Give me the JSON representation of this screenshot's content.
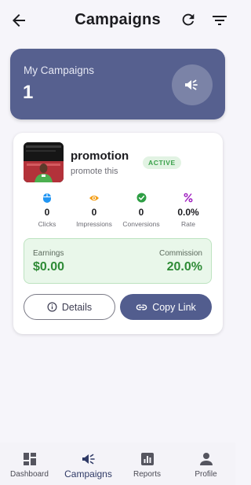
{
  "topbar": {
    "title": "Campaigns"
  },
  "summary": {
    "label": "My Campaigns",
    "count": "1"
  },
  "campaign": {
    "title": "promotion",
    "description": "promote this",
    "status": "ACTIVE",
    "metrics": [
      {
        "name": "clicks",
        "value": "0",
        "label": "Clicks",
        "icon": "mouse-icon",
        "color": "#2196f3"
      },
      {
        "name": "impressions",
        "value": "0",
        "label": "Impressions",
        "icon": "eye-icon",
        "color": "#f39c12"
      },
      {
        "name": "conversions",
        "value": "0",
        "label": "Conversions",
        "icon": "check-circle-icon",
        "color": "#2e9e44"
      },
      {
        "name": "rate",
        "value": "0.0%",
        "label": "Rate",
        "icon": "percent-icon",
        "color": "#a020c0"
      }
    ],
    "earnings_label": "Earnings",
    "earnings_value": "$0.00",
    "commission_label": "Commission",
    "commission_value": "20.0%",
    "details_label": "Details",
    "copy_label": "Copy Link"
  },
  "nav": {
    "items": [
      {
        "label": "Dashboard",
        "icon": "dashboard-icon"
      },
      {
        "label": "Campaigns",
        "icon": "megaphone-icon",
        "active": true
      },
      {
        "label": "Reports",
        "icon": "reports-icon"
      },
      {
        "label": "Profile",
        "icon": "profile-icon"
      }
    ]
  },
  "colors": {
    "accent": "#525d8e",
    "banner": "#56608f",
    "success": "#2e8b36",
    "status_bg": "#e2f3e3"
  }
}
